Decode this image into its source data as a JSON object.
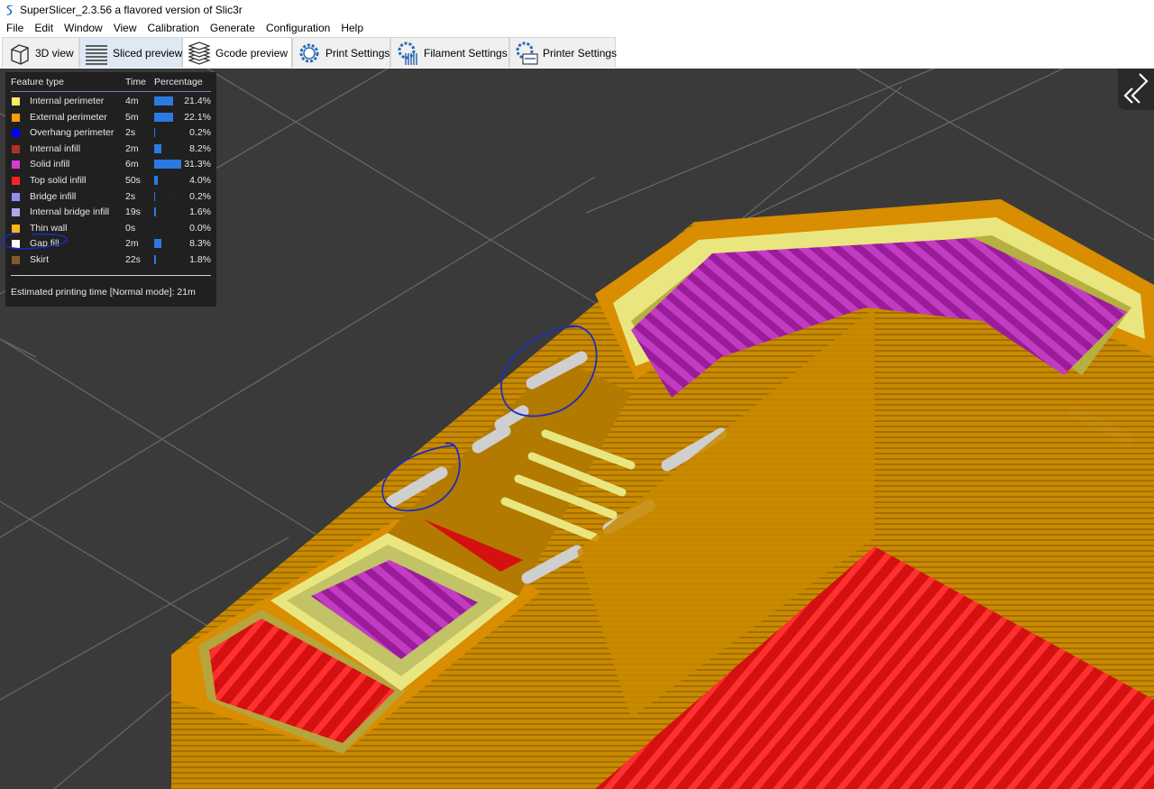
{
  "window": {
    "title": "SuperSlicer_2.3.56 a flavored version of Slic3r"
  },
  "menu": [
    "File",
    "Edit",
    "Window",
    "View",
    "Calibration",
    "Generate",
    "Configuration",
    "Help"
  ],
  "tabs": [
    {
      "label": "3D view",
      "icon": "cube-icon"
    },
    {
      "label": "Sliced preview",
      "icon": "layers-icon"
    },
    {
      "label": "Gcode preview",
      "icon": "gcode-layers-icon"
    },
    {
      "label": "Print Settings",
      "icon": "gear-icon"
    },
    {
      "label": "Filament Settings",
      "icon": "filament-gear-icon"
    },
    {
      "label": "Printer Settings",
      "icon": "printer-gear-icon"
    }
  ],
  "legend": {
    "headers": {
      "feature": "Feature type",
      "time": "Time",
      "percentage": "Percentage"
    },
    "rows": [
      {
        "name": "Internal perimeter",
        "time": "4m",
        "percentage": "21.4%",
        "fraction": 0.214,
        "color": "#ffe96b"
      },
      {
        "name": "External perimeter",
        "time": "5m",
        "percentage": "22.1%",
        "fraction": 0.221,
        "color": "#ff9c0a"
      },
      {
        "name": "Overhang perimeter",
        "time": "2s",
        "percentage": "0.2%",
        "fraction": 0.002,
        "color": "#0000ff"
      },
      {
        "name": "Internal infill",
        "time": "2m",
        "percentage": "8.2%",
        "fraction": 0.082,
        "color": "#b03028"
      },
      {
        "name": "Solid infill",
        "time": "6m",
        "percentage": "31.3%",
        "fraction": 0.313,
        "color": "#d63bd6"
      },
      {
        "name": "Top solid infill",
        "time": "50s",
        "percentage": "4.0%",
        "fraction": 0.04,
        "color": "#ff2222"
      },
      {
        "name": "Bridge infill",
        "time": "2s",
        "percentage": "0.2%",
        "fraction": 0.002,
        "color": "#9090ee"
      },
      {
        "name": "Internal bridge infill",
        "time": "19s",
        "percentage": "1.6%",
        "fraction": 0.016,
        "color": "#aaaaee"
      },
      {
        "name": "Thin wall",
        "time": "0s",
        "percentage": "0.0%",
        "fraction": 0.0,
        "color": "#ffb21a"
      },
      {
        "name": "Gap fill",
        "time": "2m",
        "percentage": "8.3%",
        "fraction": 0.083,
        "color": "#ffffff"
      },
      {
        "name": "Skirt",
        "time": "22s",
        "percentage": "1.8%",
        "fraction": 0.018,
        "color": "#835a2b"
      }
    ],
    "estimate": "Estimated printing time [Normal mode]:  21m"
  },
  "colors": {
    "viewport_bg": "#3a3a3a",
    "accent_bar": "#2a7ae2",
    "annotation": "#1b2dbf"
  }
}
